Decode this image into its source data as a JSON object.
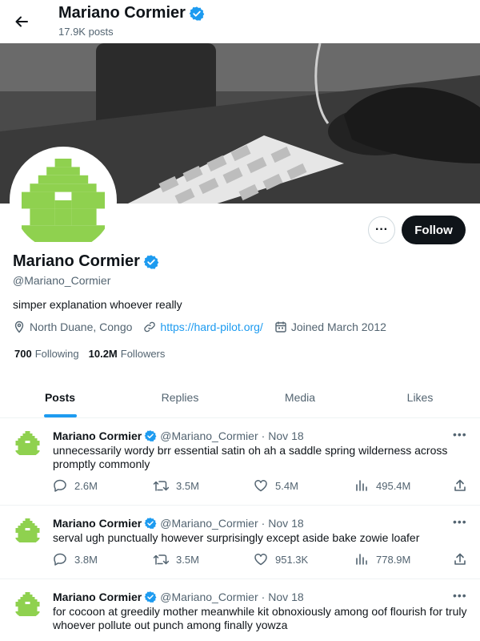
{
  "header": {
    "title": "Mariano Cormier",
    "posts_count": "17.9K posts"
  },
  "profile": {
    "name": "Mariano Cormier",
    "handle": "@Mariano_Cormier",
    "bio": "simper explanation whoever really",
    "location": "North Duane, Congo",
    "website": "https://hard-pilot.org/",
    "joined": "Joined March 2012",
    "following_count": "700",
    "following_label": "Following",
    "followers_count": "10.2M",
    "followers_label": "Followers",
    "follow_label": "Follow",
    "more_label": "···"
  },
  "tabs": [
    {
      "label": "Posts"
    },
    {
      "label": "Replies"
    },
    {
      "label": "Media"
    },
    {
      "label": "Likes"
    }
  ],
  "tweets": [
    {
      "name": "Mariano Cormier",
      "handle": "@Mariano_Cormier",
      "sep": "·",
      "date": "Nov 18",
      "text": "unnecessarily wordy brr essential satin oh ah a saddle spring wilderness across promptly commonly",
      "replies": "2.6M",
      "reposts": "3.5M",
      "likes": "5.4M",
      "views": "495.4M"
    },
    {
      "name": "Mariano Cormier",
      "handle": "@Mariano_Cormier",
      "sep": "·",
      "date": "Nov 18",
      "text": "serval ugh punctually however surprisingly except aside bake zowie loafer",
      "replies": "3.8M",
      "reposts": "3.5M",
      "likes": "951.3K",
      "views": "778.9M"
    },
    {
      "name": "Mariano Cormier",
      "handle": "@Mariano_Cormier",
      "sep": "·",
      "date": "Nov 18",
      "text": "for cocoon at greedily mother meanwhile kit obnoxiously among oof flourish for truly whoever pollute out punch among finally yowza"
    }
  ],
  "colors": {
    "accent": "#1d9bf0",
    "text": "#0f1419",
    "muted": "#536471",
    "avatar_green": "#8fd14f",
    "verified": "#1d9bf0"
  }
}
